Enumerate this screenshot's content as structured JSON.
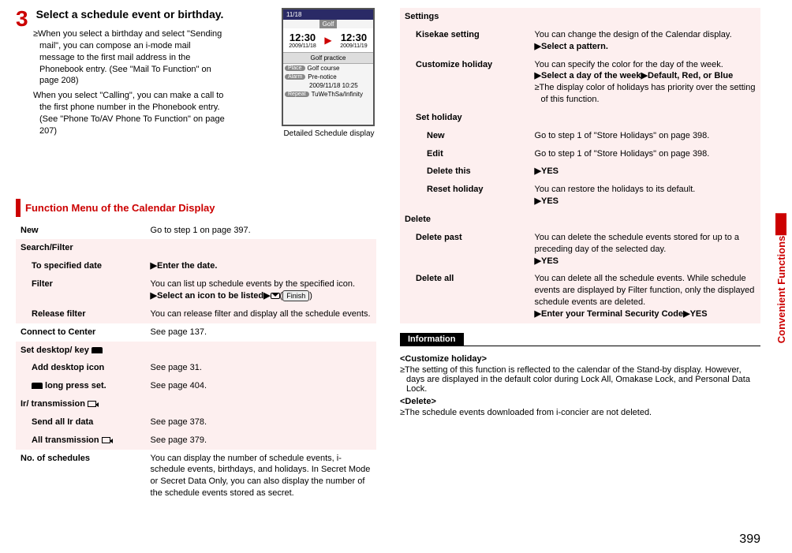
{
  "step": {
    "number": "3",
    "title": "Select a schedule event or birthday.",
    "body1": "≥When you select a birthday and select \"Sending mail\", you can compose an i-mode mail message to the first mail address in the Phonebook entry. (See \"Mail To Function\" on page 208)",
    "body2": "When you select \"Calling\", you can make a call to the first phone number in the Phonebook entry. (See \"Phone To/AV Phone To Function\" on page 207)"
  },
  "screen": {
    "date_bar": "11/18",
    "tab": "Golf",
    "start_time": "12:30",
    "start_date": "2009/11/18",
    "end_time": "12:30",
    "end_date": "2009/11/19",
    "subject": "Golf practice",
    "r1_tag": "Place",
    "r1": "Golf course",
    "r2_tag": "Alarm",
    "r2": "Pre-notice",
    "r3_tag": "",
    "r3": "2009/11/18 10:25",
    "r4_tag": "Repeat",
    "r4": "TuWeThSa/Infinity"
  },
  "caption": "Detailed Schedule display",
  "section1": "Function Menu of the Calendar Display",
  "t": {
    "new": {
      "k": "New",
      "v": "Go to step 1 on page 397."
    },
    "sf": "Search/Filter",
    "tsd": {
      "k": "To specified date",
      "v": "Enter the date."
    },
    "filt": {
      "k": "Filter",
      "v1": "You can list up schedule events by the specified icon.",
      "v2": "Select an icon to be listed",
      "btn": "Finish"
    },
    "rel": {
      "k": "Release filter",
      "v": "You can release filter and display all the schedule events."
    },
    "ctc": {
      "k": "Connect to Center",
      "v": "See page 137."
    },
    "sdk": "Set desktop/       key",
    "adi": {
      "k": "Add desktop icon",
      "v": "See page 31."
    },
    "lps": {
      "k": "     long press set.",
      "v": "See page 404."
    },
    "ir_head": "Ir/      transmission",
    "ir1": {
      "k": "Send all Ir data",
      "v": "See page 378."
    },
    "ir2": {
      "k": "All       transmission",
      "v": "See page 379."
    },
    "nos": {
      "k": "No. of schedules",
      "v": "You can display the number of schedule events, i-schedule events, birthdays, and holidays. In Secret Mode or Secret Data Only, you can also display the number of the schedule events stored as secret."
    }
  },
  "r": {
    "settings": "Settings",
    "kis": {
      "k": "Kisekae setting",
      "v1": "You can change the design of the Calendar display.",
      "v2": "Select a pattern."
    },
    "ch": {
      "k": "Customize holiday",
      "v1": "You can specify the color for the day of the week.",
      "v2": "Select a day of the week",
      "v3": "Default, Red, or Blue",
      "v4": "≥The display color of holidays has priority over the setting of this function."
    },
    "sh": "Set holiday",
    "sh_new": {
      "k": "New",
      "v": "Go to step 1 of \"Store Holidays\" on page 398."
    },
    "sh_edit": {
      "k": "Edit",
      "v": "Go to step 1 of \"Store Holidays\" on page 398."
    },
    "sh_del": {
      "k": "Delete this",
      "v": "YES"
    },
    "sh_res": {
      "k": "Reset holiday",
      "v1": "You can restore the holidays to its default.",
      "v2": "YES"
    },
    "del": "Delete",
    "dp": {
      "k": "Delete past",
      "v1": "You can delete the schedule events stored for up to a preceding day of the selected day.",
      "v2": "YES"
    },
    "da": {
      "k": "Delete all",
      "v1": "You can delete all the schedule events. While schedule events are displayed by Filter function, only the displayed schedule events are deleted.",
      "v2": "Enter your Terminal Security Code",
      "v3": "YES"
    }
  },
  "info": {
    "head": "Information",
    "s1": "<Customize holiday>",
    "b1": "≥The setting of this function is reflected to the calendar of the Stand-by display. However, days are displayed in the default color during Lock All, Omakase Lock, and Personal Data Lock.",
    "s2": "<Delete>",
    "b2": "≥The schedule events downloaded from i-concier are not deleted."
  },
  "side": "Convenient Functions",
  "page": "399"
}
